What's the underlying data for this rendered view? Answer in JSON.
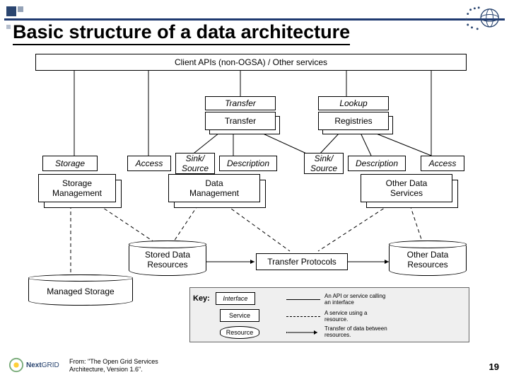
{
  "title": "Basic structure of a data architecture",
  "boxes": {
    "client_apis": "Client APIs (non-OGSA) / Other services",
    "transfer_iface": "Transfer",
    "lookup_iface": "Lookup",
    "transfer_svc": "Transfer",
    "registries_svc": "Registries",
    "storage_iface": "Storage",
    "access_iface_left": "Access",
    "sink_source_iface_left": "Sink/\nSource",
    "description_iface_left": "Description",
    "sink_source_iface_right": "Sink/\nSource",
    "description_iface_right": "Description",
    "access_iface_right": "Access",
    "storage_mgmt_svc": "Storage\nManagement",
    "data_mgmt_svc": "Data\nManagement",
    "other_data_svc": "Other Data\nServices",
    "stored_data_res": "Stored Data\nResources",
    "transfer_protocols_res": "Transfer Protocols",
    "other_data_res": "Other Data\nResources",
    "managed_storage_res": "Managed Storage"
  },
  "legend": {
    "key_label": "Key:",
    "interface": "Interface",
    "service": "Service",
    "resource": "Resource",
    "solid_desc": "An API or service calling an interface",
    "dashed_desc": "A service using a resource.",
    "arrow_desc": "Transfer of data between resources."
  },
  "footer": {
    "from": "From: \"The Open Grid Services Architecture, Version 1.6\".",
    "logo_text": "NextGRID",
    "page": "19"
  }
}
